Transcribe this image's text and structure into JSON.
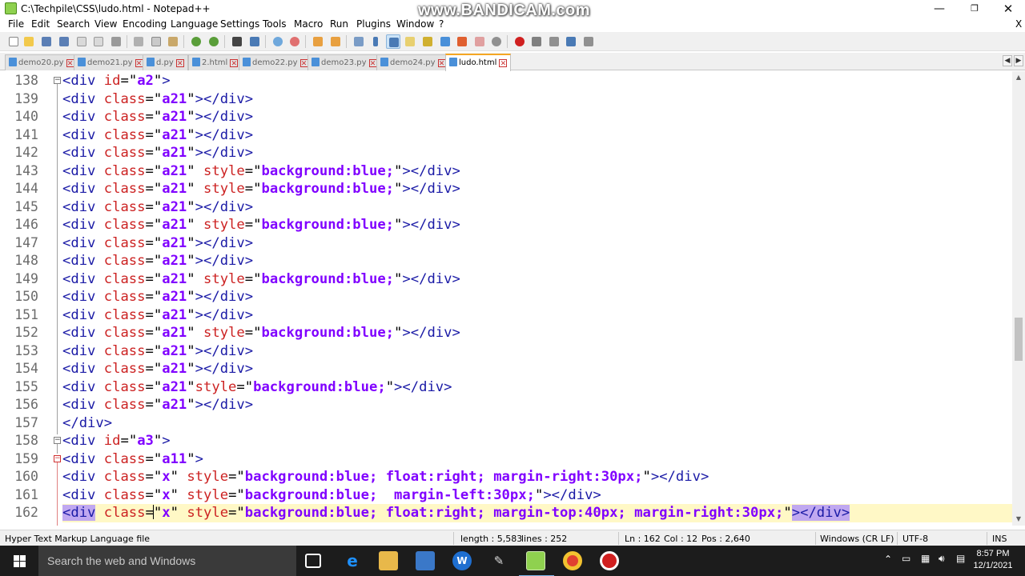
{
  "window": {
    "title": "C:\\Techpile\\CSS\\ludo.html - Notepad++",
    "watermark": "www.BANDICAM.com",
    "minimize": "—",
    "maximize": "❐",
    "close": "✕"
  },
  "menu": [
    "File",
    "Edit",
    "Search",
    "View",
    "Encoding",
    "Language",
    "Settings",
    "Tools",
    "Macro",
    "Run",
    "Plugins",
    "Window",
    "?"
  ],
  "menu_close": "X",
  "tabs": [
    {
      "label": "demo20.py",
      "active": false
    },
    {
      "label": "demo21.py",
      "active": false
    },
    {
      "label": "d.py",
      "active": false
    },
    {
      "label": "2.html",
      "active": false
    },
    {
      "label": "demo22.py",
      "active": false
    },
    {
      "label": "demo23.py",
      "active": false
    },
    {
      "label": "demo24.py",
      "active": false
    },
    {
      "label": "ludo.html",
      "active": true
    }
  ],
  "editor": {
    "line_numbers": [
      "138",
      "139",
      "140",
      "141",
      "142",
      "143",
      "144",
      "145",
      "146",
      "147",
      "148",
      "149",
      "150",
      "151",
      "152",
      "153",
      "154",
      "155",
      "156",
      "157",
      "158",
      "159",
      "160",
      "161",
      "162"
    ],
    "lines": [
      "<div id=\"a2\">",
      "<div class=\"a21\"></div>",
      "<div class=\"a21\"></div>",
      "<div class=\"a21\"></div>",
      "<div class=\"a21\"></div>",
      "<div class=\"a21\" style=\"background:blue;\"></div>",
      "<div class=\"a21\" style=\"background:blue;\"></div>",
      "<div class=\"a21\"></div>",
      "<div class=\"a21\" style=\"background:blue;\"></div>",
      "<div class=\"a21\"></div>",
      "<div class=\"a21\"></div>",
      "<div class=\"a21\" style=\"background:blue;\"></div>",
      "<div class=\"a21\"></div>",
      "<div class=\"a21\"></div>",
      "<div class=\"a21\" style=\"background:blue;\"></div>",
      "<div class=\"a21\"></div>",
      "<div class=\"a21\"></div>",
      "<div class=\"a21\"style=\"background:blue;\"></div>",
      "<div class=\"a21\"></div>",
      "</div>",
      "<div id=\"a3\">",
      "<div class=\"a11\">",
      "<div class=\"x\" style=\"background:blue; float:right; margin-right:30px;\"></div>",
      "<div class=\"x\" style=\"background:blue;  margin-left:30px;\"></div>",
      "<div class=\"x\" style=\"background:blue; float:right; margin-top:40px; margin-right:30px;\"></div>"
    ]
  },
  "status": {
    "file_type": "Hyper Text Markup Language file",
    "length": "length : 5,583",
    "lines": "lines : 252",
    "ln": "Ln : 162",
    "col": "Col : 12",
    "pos": "Pos : 2,640",
    "eol": "Windows (CR LF)",
    "encoding": "UTF-8",
    "mode": "INS"
  },
  "taskbar": {
    "search_placeholder": "Search the web and Windows",
    "time": "8:57 PM",
    "date": "12/1/2021"
  },
  "colors": {
    "tag": "#1a1aa6",
    "attribute": "#cc2222",
    "value": "#8000ff",
    "current_line": "#fff8c6",
    "selection": "#c0a8f0",
    "taskbar": "#1c1c1c"
  }
}
